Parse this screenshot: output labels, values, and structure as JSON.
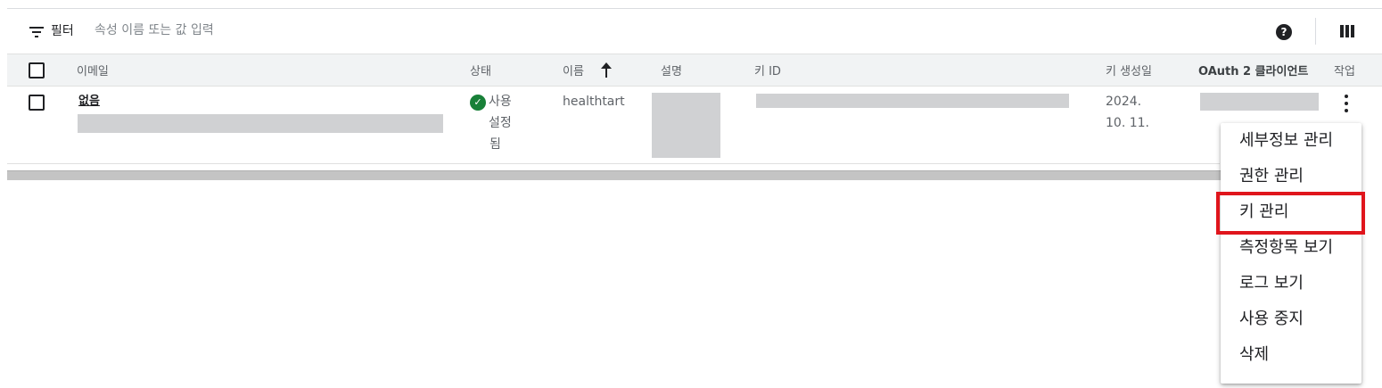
{
  "filterbar": {
    "label": "필터",
    "placeholder": "속성 이름 또는 값 입력",
    "help_icon": "help-circle-icon",
    "columns_icon": "column-display-icon"
  },
  "table": {
    "headers": {
      "email": "이메일",
      "status": "상태",
      "name": "이름",
      "description": "설명",
      "key_id": "키 ID",
      "key_created": "키 생성일",
      "oauth_client": "OAuth 2 클라이언트",
      "actions": "작업"
    },
    "sort": {
      "column": "name",
      "direction": "ascending",
      "icon": "arrow-up-icon"
    },
    "rows": [
      {
        "email_prefix": "없음",
        "status_line1": "사용",
        "status_line2": "설정",
        "status_line3": "됨",
        "status_color": "#188038",
        "name": "healthtart",
        "key_created_line1": "2024.",
        "key_created_line2": "10. 11."
      }
    ]
  },
  "menu": {
    "items": [
      "세부정보 관리",
      "권한 관리",
      "키 관리",
      "측정항목 보기",
      "로그 보기",
      "사용 중지",
      "삭제"
    ],
    "highlighted": "키 관리",
    "highlight_color": "#e0151c"
  }
}
